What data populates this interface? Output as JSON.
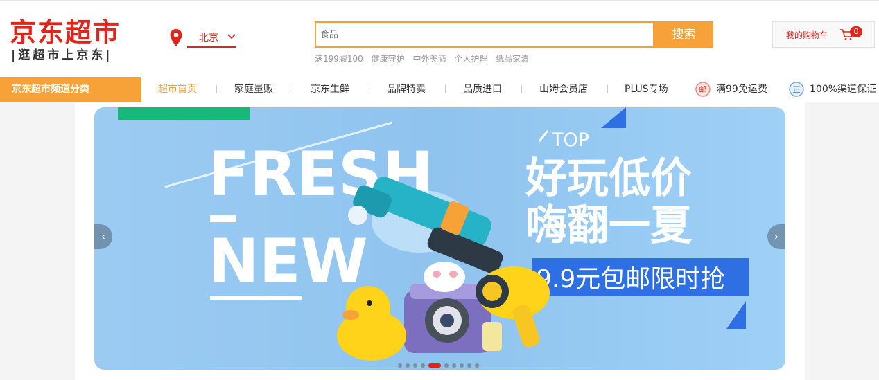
{
  "logo": {
    "main": "京东超市",
    "sub": "逛超市上京东"
  },
  "location": {
    "city": "北京",
    "icon": "location-pin-icon"
  },
  "search": {
    "placeholder": "食品",
    "button": "搜索"
  },
  "hotwords": [
    "满199减100",
    "健康守护",
    "中外美酒",
    "个人护理",
    "纸品家清"
  ],
  "cart": {
    "label": "我的购物车",
    "count": "0",
    "icon": "cart-icon"
  },
  "nav": {
    "category": "京东超市频道分类",
    "items": [
      "超市首页",
      "家庭量贩",
      "京东生鲜",
      "品牌特卖",
      "品质进口",
      "山姆会员店",
      "PLUS专场"
    ],
    "promos": [
      {
        "icon": "mail-badge-icon",
        "icon_char": "邮",
        "text": "满99免运费"
      },
      {
        "icon": "genuine-badge-icon",
        "icon_char": "正",
        "text": "100%渠道保证"
      }
    ]
  },
  "banner": {
    "fresh": "FRESH",
    "new": "NEW",
    "top": "TOP",
    "headline1": "好玩低价",
    "headline2": "嗨翻一夏",
    "price_tag": "9.9元包邮限时抢",
    "slide_count": 10,
    "active_slide": 5
  },
  "colors": {
    "brand_red": "#e1251b",
    "accent_orange": "#f7a239",
    "banner_blue": "#8cc8f0"
  }
}
